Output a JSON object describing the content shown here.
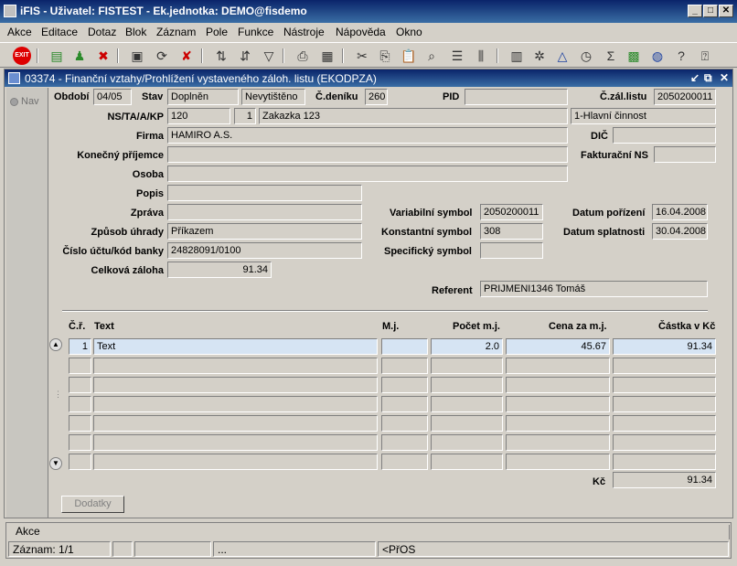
{
  "app": {
    "title": "iFIS - Uživatel: FISTEST - Ek.jednotka: DEMO@fisdemo"
  },
  "window_controls": {
    "minimize": "_",
    "maximize": "□",
    "close": "✕"
  },
  "menu": [
    "Akce",
    "Editace",
    "Dotaz",
    "Blok",
    "Záznam",
    "Pole",
    "Funkce",
    "Nástroje",
    "Nápověda",
    "Okno"
  ],
  "toolbar": {
    "exit_label": "EXIT",
    "sigma": "Σ",
    "help": "?"
  },
  "form": {
    "title": "03374 - Finanční vztahy/Prohlížení vystaveného záloh. listu (EKODPZA)",
    "nav_label": "Nav",
    "labels": {
      "obdobi": "Období",
      "stav": "Stav",
      "cdeniku": "Č.deníku",
      "pid": "PID",
      "czal": "Č.zál.listu",
      "ns": "NS/TA/A/KP",
      "firma": "Firma",
      "dic": "DIČ",
      "kp": "Konečný příjemce",
      "fns": "Fakturační NS",
      "osoba": "Osoba",
      "popis": "Popis",
      "zprava": "Zpráva",
      "vs": "Variabilní symbol",
      "dp": "Datum pořízení",
      "zu": "Způsob úhrady",
      "ks": "Konstantní symbol",
      "ds": "Datum splatnosti",
      "cu": "Číslo účtu/kód banky",
      "ss": "Specifický symbol",
      "cz": "Celková záloha",
      "ref": "Referent"
    },
    "values": {
      "obdobi": "04/05",
      "stav1": "Doplněn",
      "stav2": "Nevytištěno",
      "cdeniku": "260",
      "pid": "",
      "czal": "2050200011",
      "ns": "120",
      "ta": "1",
      "zakazka": "Zakazka 123",
      "kp_cinnost": "1-Hlavní činnost",
      "firma": "HAMIRO A.S.",
      "dic": "",
      "konecny": "",
      "fakt_ns": "",
      "osoba": "",
      "popis": "",
      "zprava": "",
      "vs": "2050200011",
      "dp": "16.04.2008",
      "zu": "Příkazem",
      "ks": "308",
      "ds": "30.04.2008",
      "cu": "24828091/0100",
      "ss": "",
      "cz": "91.34",
      "ref": "PRIJMENI1346 Tomáš"
    }
  },
  "table": {
    "headers": [
      "Č.ř.",
      "Text",
      "M.j.",
      "Počet m.j.",
      "Cena za m.j.",
      "Částka v Kč"
    ],
    "rows": [
      {
        "cr": "1",
        "text": "Text",
        "mj": "",
        "pocet": "2.0",
        "cena": "45.67",
        "castka": "91.34"
      }
    ],
    "total_label": "Kč",
    "total": "91.34"
  },
  "buttons": {
    "dodatky": "Dodatky"
  },
  "status": {
    "title": "Akce",
    "zaznam": "Záznam: 1/1",
    "dots": "...",
    "osc": "<PřOS"
  }
}
